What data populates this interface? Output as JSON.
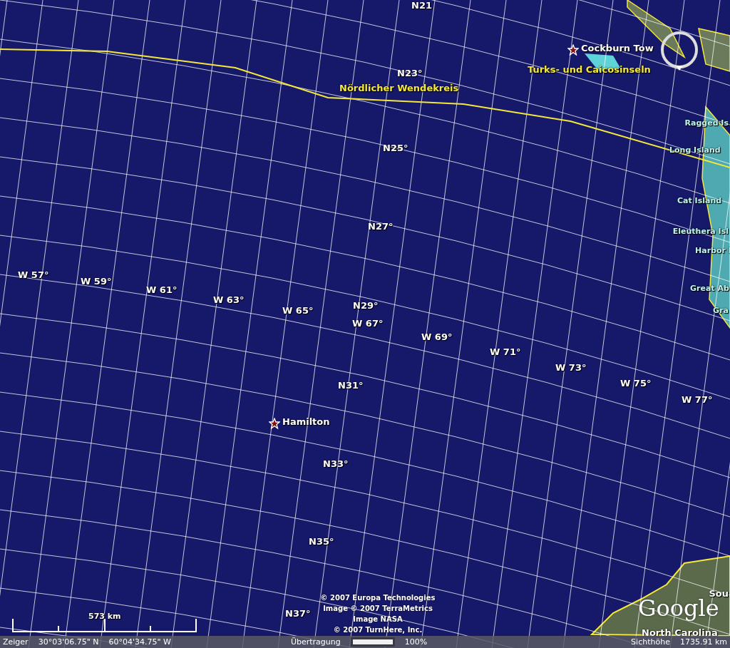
{
  "map": {
    "grid_labels": [
      "N21",
      "N23°",
      "N25°",
      "N27°",
      "N29°",
      "N31°",
      "N33°",
      "N35°",
      "N37°",
      "W 57°",
      "W 59°",
      "W 61°",
      "W 63°",
      "W 65°",
      "W 67°",
      "W 69°",
      "W 71°",
      "W 73°",
      "W 75°",
      "W 77°"
    ],
    "places": [
      {
        "text": "Hamilton",
        "kind": "capital"
      },
      {
        "text": "Cockburn Tow",
        "kind": "capital"
      },
      {
        "text": "Turks- und Caicosinseln",
        "kind": "region"
      },
      {
        "text": "Nördlicher Wendekreis",
        "kind": "region"
      },
      {
        "text": "Ragged Is",
        "kind": "island"
      },
      {
        "text": "Long Island",
        "kind": "island"
      },
      {
        "text": "Cat Island",
        "kind": "island"
      },
      {
        "text": "Eleuthera Isl",
        "kind": "island"
      },
      {
        "text": "Harbor I",
        "kind": "island"
      },
      {
        "text": "Great Ab",
        "kind": "island"
      },
      {
        "text": "Gra",
        "kind": "island"
      },
      {
        "text": "Sou",
        "kind": "place"
      },
      {
        "text": "North Carolina",
        "kind": "place"
      }
    ],
    "attribution": [
      "© 2007 Europa Technologies",
      "Image © 2007 TerraMetrics",
      "Image NASA",
      "© 2007 TurnHere, Inc."
    ],
    "logo": "Google",
    "scale": "573 km"
  },
  "status_bar": {
    "pointer_label": "Zeiger",
    "latitude": "30°03'06.75\" N",
    "longitude": "60°04'34.75\" W",
    "streaming_label": "Übertragung",
    "level": 1,
    "streaming_percent": "100%",
    "altitude_label": "Sichthöhe",
    "altitude": "1735.91 km"
  }
}
